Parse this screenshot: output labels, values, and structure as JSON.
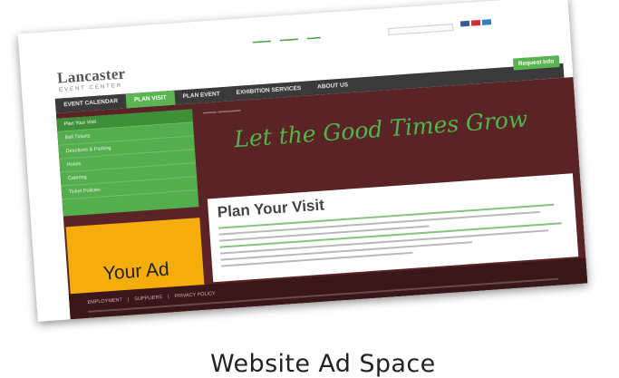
{
  "site": {
    "logo_title": "Lancaster",
    "logo_subtitle": "EVENT CENTER"
  },
  "nav": {
    "tabs": [
      {
        "label": "EVENT CALENDAR"
      },
      {
        "label": "PLAN VISIT"
      },
      {
        "label": "PLAN EVENT"
      },
      {
        "label": "EXHIBITION SERVICES"
      },
      {
        "label": "ABOUT US"
      }
    ],
    "request_button": "Request Info"
  },
  "sidebar": {
    "items": [
      {
        "label": "Plan Your Visit"
      },
      {
        "label": "Bell Tickets"
      },
      {
        "label": "Directions & Parking"
      },
      {
        "label": "Hotels"
      },
      {
        "label": "Catering"
      },
      {
        "label": "Ticket Policies"
      }
    ]
  },
  "ad": {
    "label": "Your Ad"
  },
  "banner": {
    "text": "Let the Good Times Grow"
  },
  "main": {
    "title": "Plan Your Visit"
  },
  "footer": {
    "links": [
      "EMPLOYMENT",
      "|",
      "SUPPLIERS",
      "|",
      "PRIVACY POLICY"
    ]
  },
  "caption": "Website Ad Space"
}
